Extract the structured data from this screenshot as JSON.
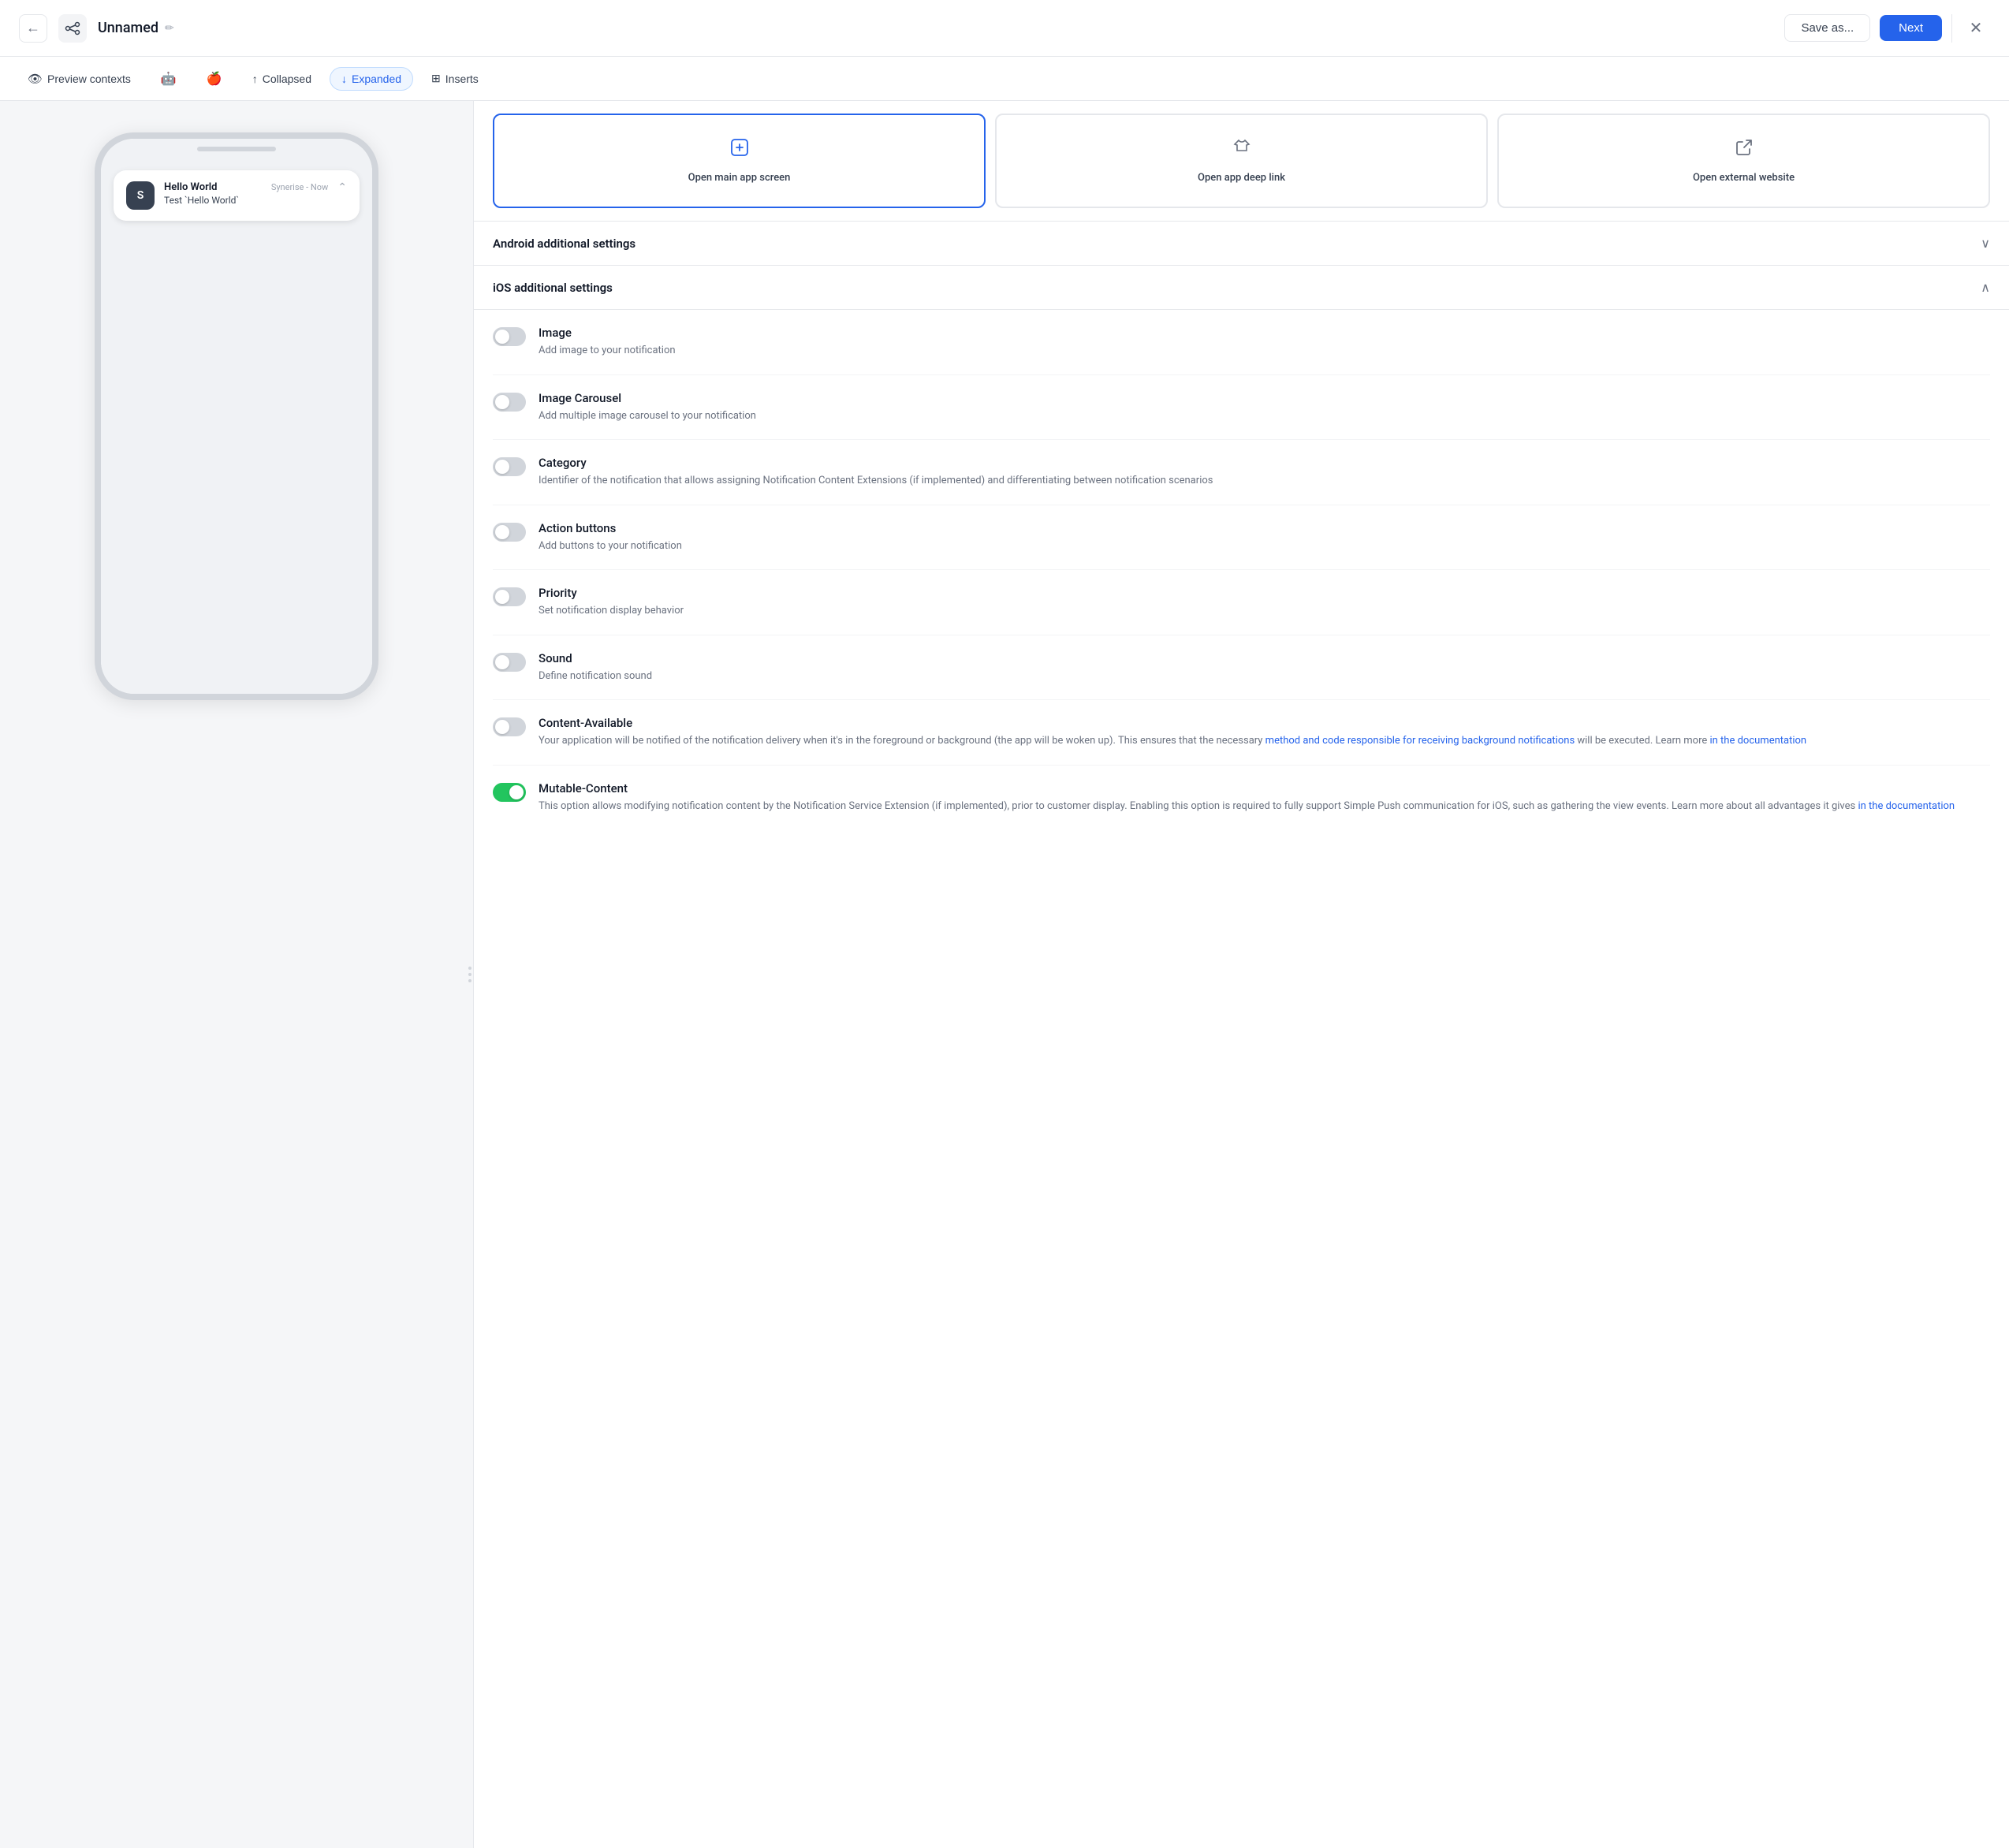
{
  "topbar": {
    "title": "Unnamed",
    "save_label": "Save as...",
    "next_label": "Next"
  },
  "toolbar": {
    "preview_label": "Preview contexts",
    "collapsed_label": "Collapsed",
    "expanded_label": "Expanded",
    "inserts_label": "Inserts",
    "active_tab": "Expanded"
  },
  "preview": {
    "notification": {
      "app_initial": "S",
      "title": "Hello World",
      "source": "Synerise - Now",
      "body": "Test `Hello World`"
    }
  },
  "action_cards": [
    {
      "id": "open-main-app-screen",
      "label": "Open main app screen",
      "icon": "cursor",
      "active": true
    },
    {
      "id": "open-app-deep-link",
      "label": "Open app deep link",
      "icon": "shirt",
      "active": false
    },
    {
      "id": "open-external-website",
      "label": "Open external website",
      "icon": "cursor-external",
      "active": false
    }
  ],
  "android_section": {
    "label": "Android additional settings",
    "expanded": false
  },
  "ios_section": {
    "label": "iOS additional settings",
    "expanded": true
  },
  "ios_settings": [
    {
      "id": "image",
      "title": "Image",
      "desc": "Add image to your notification",
      "enabled": false
    },
    {
      "id": "image-carousel",
      "title": "Image Carousel",
      "desc": "Add multiple image carousel to your notification",
      "enabled": false
    },
    {
      "id": "category",
      "title": "Category",
      "desc": "Identifier of the notification that allows assigning Notification Content Extensions (if implemented) and differentiating between notification scenarios",
      "enabled": false
    },
    {
      "id": "action-buttons",
      "title": "Action buttons",
      "desc": "Add buttons to your notification",
      "enabled": false
    },
    {
      "id": "priority",
      "title": "Priority",
      "desc": "Set notification display behavior",
      "enabled": false
    },
    {
      "id": "sound",
      "title": "Sound",
      "desc": "Define notification sound",
      "enabled": false
    },
    {
      "id": "content-available",
      "title": "Content-Available",
      "desc_plain": "Your application will be notified of the notification delivery when it's in the foreground or background (the app will be woken up). This ensures that the necessary ",
      "desc_link1": "method and code responsible for receiving background notifications",
      "desc_mid": " will be executed. Learn more ",
      "desc_link2": "in the documentation",
      "enabled": false
    },
    {
      "id": "mutable-content",
      "title": "Mutable-Content",
      "desc_plain": "This option allows modifying notification content by the Notification Service Extension (if implemented), prior to customer display. Enabling this option is required to fully support Simple Push communication for iOS, such as gathering the view events. Learn more about all advantages it gives ",
      "desc_link": "in the documentation",
      "enabled": true
    }
  ]
}
